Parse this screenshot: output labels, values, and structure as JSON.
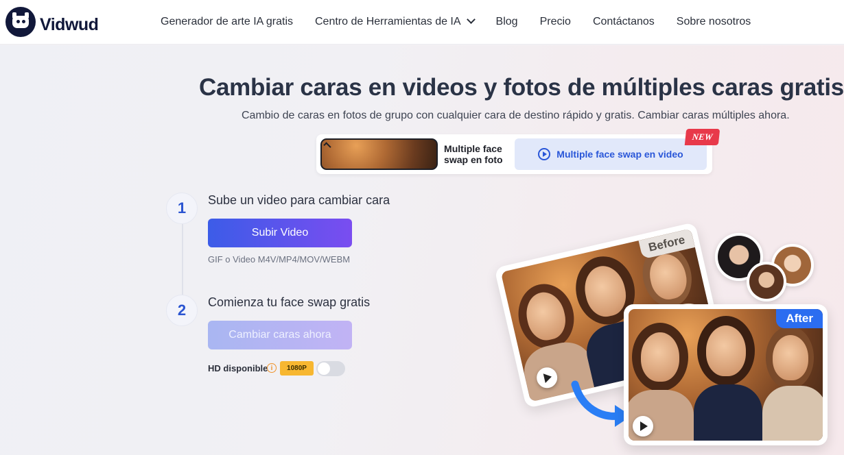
{
  "brand": {
    "name": "Vidwud"
  },
  "nav": {
    "items": [
      {
        "label": "Generador de arte IA gratis"
      },
      {
        "label": "Centro de Herramientas de IA",
        "has_dropdown": true
      },
      {
        "label": "Blog"
      },
      {
        "label": "Precio"
      },
      {
        "label": "Contáctanos"
      },
      {
        "label": "Sobre nosotros"
      }
    ]
  },
  "hero": {
    "title": "Cambiar caras en videos y fotos de múltiples caras gratis",
    "subtitle": "Cambio de caras en fotos de grupo con cualquier cara de destino rápido y gratis. Cambiar caras múltiples ahora."
  },
  "tabs": [
    {
      "label": "Multiple face swap en foto",
      "icon": "photo-icon",
      "active": false
    },
    {
      "label": "Multiple face swap en video",
      "icon": "play-circle-icon",
      "active": true
    }
  ],
  "new_badge": "NEW",
  "steps": [
    {
      "number": "1",
      "label": "Sube un video para cambiar cara"
    },
    {
      "number": "2",
      "label": "Comienza tu face swap gratis"
    }
  ],
  "upload": {
    "button_label": "Subir Video",
    "formats": "GIF o Video M4V/MP4/MOV/WEBM"
  },
  "swap": {
    "button_label": "Cambiar caras ahora"
  },
  "hd": {
    "label": "HD disponible",
    "info_glyph": "i",
    "resolution_badge": "1080P",
    "toggle_on": false
  },
  "illustration": {
    "before_label": "Before",
    "after_label": "After"
  },
  "colors": {
    "accent": "#2b55d1",
    "tab_active_bg": "#e1e8fa",
    "new_badge": "#e8394a",
    "res_badge": "#f7b731",
    "after_label": "#2b6df0"
  }
}
